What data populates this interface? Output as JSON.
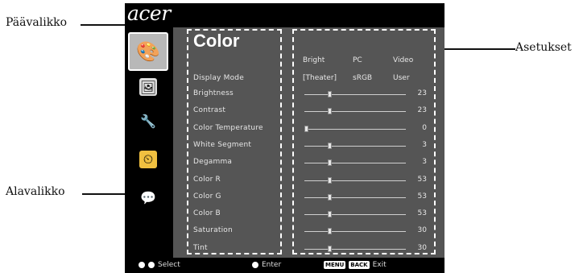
{
  "callouts": {
    "main_menu": "Päävalikko",
    "sub_menu": "Alavalikko",
    "settings": "Asetukset"
  },
  "osd": {
    "brand": "acer",
    "title": "Color",
    "sidebar_icons": [
      "picture-icon",
      "image-icon",
      "settings-wrench-icon",
      "timer-icon",
      "language-icon"
    ],
    "columns": [
      "Bright",
      "PC",
      "Video"
    ],
    "display_mode": {
      "label": "Display Mode",
      "options": [
        "[Theater]",
        "sRGB",
        "User"
      ]
    },
    "items": [
      {
        "label": "Brightness",
        "value": "23",
        "level": 0.23
      },
      {
        "label": "Contrast",
        "value": "23",
        "level": 0.23
      },
      {
        "label": "Color Temperature",
        "value": "0",
        "level": 0.0
      },
      {
        "label": "White Segment",
        "value": "3",
        "level": 0.23
      },
      {
        "label": "Degamma",
        "value": "3",
        "level": 0.23
      },
      {
        "label": "Color R",
        "value": "53",
        "level": 0.23
      },
      {
        "label": "Color G",
        "value": "53",
        "level": 0.23
      },
      {
        "label": "Color B",
        "value": "53",
        "level": 0.23
      },
      {
        "label": "Saturation",
        "value": "30",
        "level": 0.23
      },
      {
        "label": "Tint",
        "value": "30",
        "level": 0.23
      }
    ],
    "footer": {
      "select": "Select",
      "enter": "Enter",
      "menu_key": "MENU",
      "back_key": "BACK",
      "exit": "Exit"
    }
  }
}
